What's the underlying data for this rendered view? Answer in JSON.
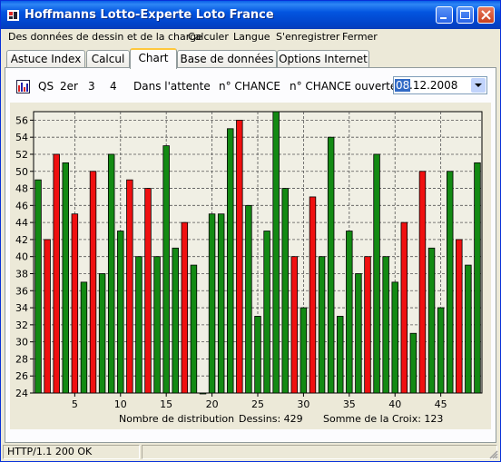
{
  "window": {
    "title": "Hoffmanns Lotto-Experte Loto France"
  },
  "menu": [
    {
      "label": "Des données de dessin et de la charge"
    },
    {
      "label": "Calculer"
    },
    {
      "label": "Langue"
    },
    {
      "label": "S'enregistrer"
    },
    {
      "label": "Fermer"
    }
  ],
  "tabs": [
    {
      "label": "Astuce Index"
    },
    {
      "label": "Calcul"
    },
    {
      "label": "Chart"
    },
    {
      "label": "Base de données"
    },
    {
      "label": "Options Internet"
    }
  ],
  "toolbar": {
    "qs": "QS",
    "second": "2er",
    "three": "3",
    "four": "4",
    "waiting": "Dans l'attente",
    "chance": "n° CHANCE",
    "chance_open": "n° CHANCE ouverte",
    "date_selected": "08",
    "date_rest": ".12.2008"
  },
  "status": {
    "text": "HTTP/1.1 200 OK",
    "cell2": ""
  },
  "colors": {
    "green": "#138A13",
    "red": "#F01010",
    "plot_bg": "#F0EFE4"
  },
  "chart_data": {
    "type": "bar",
    "x": [
      1,
      2,
      3,
      4,
      5,
      6,
      7,
      8,
      9,
      10,
      11,
      12,
      13,
      14,
      15,
      16,
      17,
      18,
      19,
      20,
      21,
      22,
      23,
      24,
      25,
      26,
      27,
      28,
      29,
      30,
      31,
      32,
      33,
      34,
      35,
      36,
      37,
      38,
      39,
      40,
      41,
      42,
      43,
      44,
      45,
      46,
      47,
      48,
      49
    ],
    "values": [
      49,
      42,
      52,
      51,
      45,
      37,
      50,
      38,
      52,
      43,
      49,
      40,
      48,
      40,
      53,
      41,
      44,
      39,
      24,
      45,
      45,
      55,
      56,
      46,
      33,
      43,
      57,
      48,
      40,
      34,
      47,
      40,
      54,
      33,
      43,
      38,
      40,
      52,
      40,
      37,
      44,
      31,
      50,
      41,
      34,
      50,
      42,
      39,
      51
    ],
    "colors": [
      "green",
      "red",
      "red",
      "green",
      "red",
      "green",
      "red",
      "green",
      "green",
      "green",
      "red",
      "green",
      "red",
      "green",
      "green",
      "green",
      "red",
      "green",
      "green",
      "green",
      "green",
      "green",
      "red",
      "green",
      "green",
      "green",
      "green",
      "green",
      "red",
      "green",
      "red",
      "green",
      "green",
      "green",
      "green",
      "green",
      "red",
      "green",
      "green",
      "green",
      "red",
      "green",
      "red",
      "green",
      "green",
      "green",
      "red",
      "green",
      "green"
    ],
    "ylim": [
      24,
      57
    ],
    "yticks": [
      24,
      26,
      28,
      30,
      32,
      34,
      36,
      38,
      40,
      42,
      44,
      46,
      48,
      50,
      52,
      54,
      56
    ],
    "xticks": [
      5,
      10,
      15,
      20,
      25,
      30,
      35,
      40,
      45
    ],
    "xlabel": "Nombre de distribution",
    "info1": "Dessins: 429",
    "info2": "Somme de la Croix: 123",
    "grid": true
  }
}
